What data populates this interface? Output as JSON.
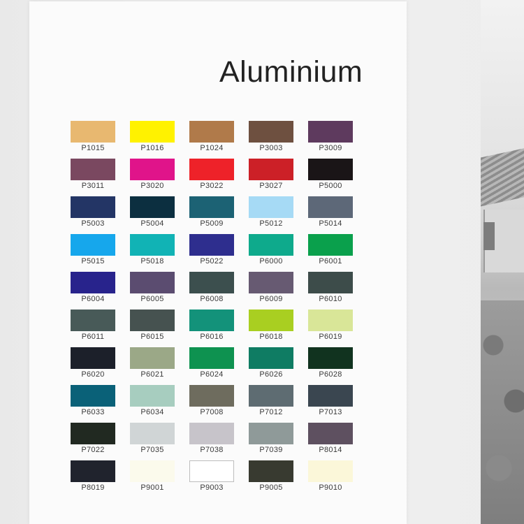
{
  "title": "Aluminium",
  "swatches": [
    {
      "code": "P1015",
      "color": "#E8B870"
    },
    {
      "code": "P1016",
      "color": "#FFF200"
    },
    {
      "code": "P1024",
      "color": "#B07A4A"
    },
    {
      "code": "P3003",
      "color": "#6E5040"
    },
    {
      "code": "P3009",
      "color": "#5E3A5E"
    },
    {
      "code": "P3011",
      "color": "#7A4860"
    },
    {
      "code": "P3020",
      "color": "#E0148A"
    },
    {
      "code": "P3022",
      "color": "#EE2229"
    },
    {
      "code": "P3027",
      "color": "#CC2027"
    },
    {
      "code": "P5000",
      "color": "#1A1517"
    },
    {
      "code": "P5003",
      "color": "#233565"
    },
    {
      "code": "P5004",
      "color": "#0C2F40"
    },
    {
      "code": "P5009",
      "color": "#1C6274"
    },
    {
      "code": "P5012",
      "color": "#A6DAF5"
    },
    {
      "code": "P5014",
      "color": "#5D6878"
    },
    {
      "code": "P5015",
      "color": "#16A7EC"
    },
    {
      "code": "P5018",
      "color": "#11B3B5"
    },
    {
      "code": "P5022",
      "color": "#2E2E8E"
    },
    {
      "code": "P6000",
      "color": "#0EAA8C"
    },
    {
      "code": "P6001",
      "color": "#0AA04C"
    },
    {
      "code": "P6004",
      "color": "#28238C"
    },
    {
      "code": "P6005",
      "color": "#5B4C70"
    },
    {
      "code": "P6008",
      "color": "#3C4F4E"
    },
    {
      "code": "P6009",
      "color": "#675A72"
    },
    {
      "code": "P6010",
      "color": "#3D4C4A"
    },
    {
      "code": "P6011",
      "color": "#485A58"
    },
    {
      "code": "P6015",
      "color": "#465250"
    },
    {
      "code": "P6016",
      "color": "#13927A"
    },
    {
      "code": "P6018",
      "color": "#A9CF21"
    },
    {
      "code": "P6019",
      "color": "#D9E698"
    },
    {
      "code": "P6020",
      "color": "#1C202A"
    },
    {
      "code": "P6021",
      "color": "#9BA887"
    },
    {
      "code": "P6024",
      "color": "#0E9250"
    },
    {
      "code": "P6026",
      "color": "#0F7C63"
    },
    {
      "code": "P6028",
      "color": "#11331F"
    },
    {
      "code": "P6033",
      "color": "#0A6178"
    },
    {
      "code": "P6034",
      "color": "#A7CDBF"
    },
    {
      "code": "P7008",
      "color": "#6E6C5E"
    },
    {
      "code": "P7012",
      "color": "#5E6C72"
    },
    {
      "code": "P7013",
      "color": "#3A4650"
    },
    {
      "code": "P7022",
      "color": "#212921"
    },
    {
      "code": "P7035",
      "color": "#D0D5D6"
    },
    {
      "code": "P7038",
      "color": "#C7C4CA"
    },
    {
      "code": "P7039",
      "color": "#8F9A99"
    },
    {
      "code": "P8014",
      "color": "#5E5060"
    },
    {
      "code": "P8019",
      "color": "#20232D"
    },
    {
      "code": "P9001",
      "color": "#FBFAEC"
    },
    {
      "code": "P9003",
      "color": "#FFFFFF"
    },
    {
      "code": "P9005",
      "color": "#383A30"
    },
    {
      "code": "P9010",
      "color": "#FBF7D9"
    }
  ]
}
